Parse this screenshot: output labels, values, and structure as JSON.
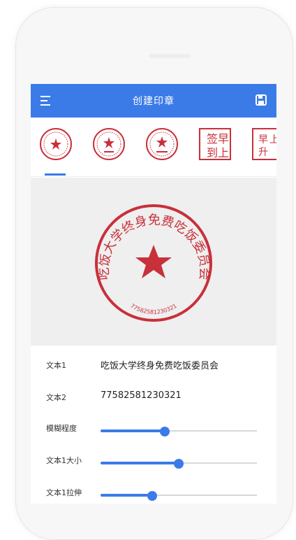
{
  "appbar": {
    "title": "创建印章",
    "menu_icon": "menu-icon",
    "save_icon": "save-icon",
    "color": "#3b7be8"
  },
  "thumbnails": [
    {
      "type": "round-seal",
      "label": ""
    },
    {
      "type": "round-seal",
      "label": ""
    },
    {
      "type": "round-seal",
      "label": ""
    },
    {
      "type": "square-seal",
      "label": "签早到上"
    },
    {
      "type": "square-seal",
      "label": "早上升"
    }
  ],
  "preview": {
    "seal_text": "吃饭大学终身免费吃饭委员会",
    "seal_number": "77582581230321",
    "seal_color": "#c8303a"
  },
  "form": {
    "text1": {
      "label": "文本1",
      "value": "吃饭大学终身免费吃饭委员会"
    },
    "text2": {
      "label": "文本2",
      "value": "77582581230321"
    },
    "blur": {
      "label": "模糊程度",
      "value": 0.41
    },
    "text1_size": {
      "label": "文本1大小",
      "value": 0.5
    },
    "text1_stretch": {
      "label": "文本1拉伸",
      "value": 0.33
    }
  }
}
